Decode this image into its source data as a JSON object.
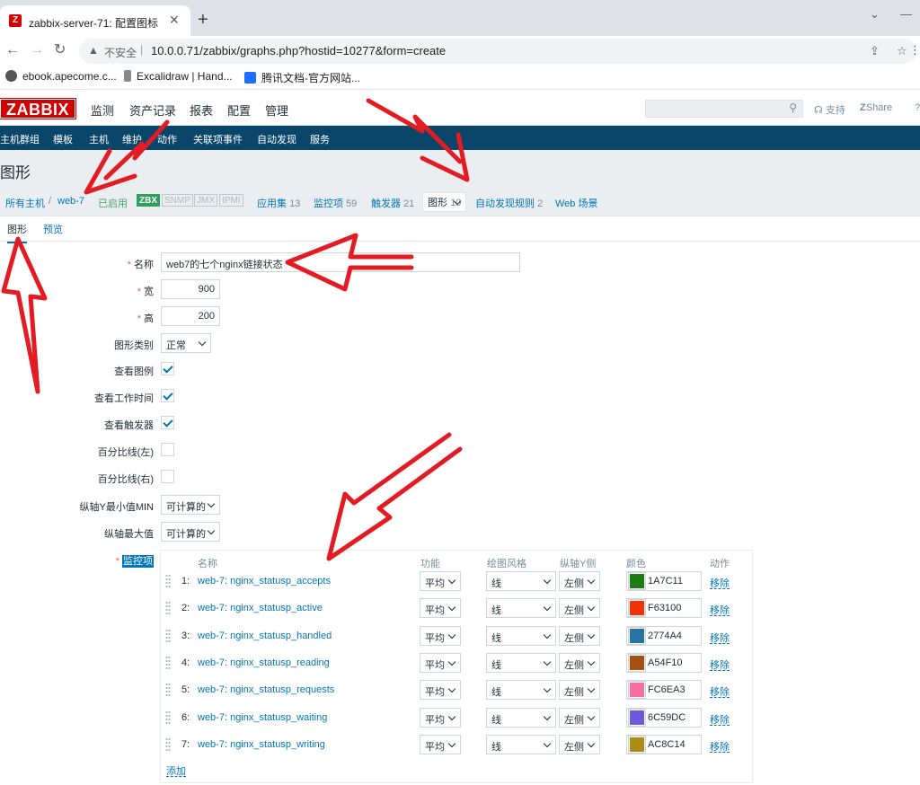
{
  "browser": {
    "tab_title": "zabbix-server-71: 配置图标",
    "url_warning": "不安全",
    "url": "10.0.0.71/zabbix/graphs.php?hostid=10277&form=create",
    "bookmarks": [
      "ebook.apecome.c...",
      "Excalidraw | Hand...",
      "腾讯文档-官方网站..."
    ]
  },
  "header": {
    "logo": "ZABBIX",
    "menu": [
      "监测",
      "资产记录",
      "报表",
      "配置",
      "管理"
    ],
    "support": "支持",
    "share": "Share"
  },
  "submenu": [
    "主机群组",
    "模板",
    "主机",
    "维护",
    "动作",
    "关联项事件",
    "自动发现",
    "服务"
  ],
  "page_title": "图形",
  "breadcrumbs": {
    "all_hosts": "所有主机",
    "separator": "/",
    "host": "web-7",
    "status": "已启用",
    "tags": [
      "ZBX",
      "SNMP",
      "JMX",
      "IPMI"
    ],
    "applications": {
      "label": "应用集",
      "count": "13"
    },
    "items": {
      "label": "监控项",
      "count": "59"
    },
    "triggers": {
      "label": "触发器",
      "count": "21"
    },
    "graphs": {
      "label": "图形",
      "count": "10"
    },
    "discovery": {
      "label": "自动发现规则",
      "count": "2"
    },
    "web": {
      "label": "Web 场景"
    }
  },
  "form_tabs": [
    "图形",
    "预览"
  ],
  "form": {
    "name_label": "名称",
    "name_value": "web7的七个nginx链接状态",
    "width_label": "宽",
    "width_value": "900",
    "height_label": "高",
    "height_value": "200",
    "type_label": "图形类别",
    "type_value": "正常",
    "legend_label": "查看图例",
    "worktime_label": "查看工作时间",
    "triggers_label": "查看触发器",
    "pct_left_label": "百分比线(左)",
    "pct_right_label": "百分比线(右)",
    "ymin_label": "纵轴Y最小值MIN",
    "ymin_value": "可计算的",
    "ymax_label": "纵轴最大值",
    "ymax_value": "可计算的",
    "items_label": "监控项"
  },
  "items_table": {
    "headers": [
      "名称",
      "功能",
      "绘图风格",
      "纵轴Y侧",
      "颜色",
      "动作"
    ],
    "rows": [
      {
        "num": "1:",
        "name": "web-7: nginx_statusp_accepts",
        "func": "平均",
        "style": "线",
        "side": "左侧",
        "color": "1A7C11",
        "action": "移除"
      },
      {
        "num": "2:",
        "name": "web-7: nginx_statusp_active",
        "func": "平均",
        "style": "线",
        "side": "左侧",
        "color": "F63100",
        "action": "移除"
      },
      {
        "num": "3:",
        "name": "web-7: nginx_statusp_handled",
        "func": "平均",
        "style": "线",
        "side": "左侧",
        "color": "2774A4",
        "action": "移除"
      },
      {
        "num": "4:",
        "name": "web-7: nginx_statusp_reading",
        "func": "平均",
        "style": "线",
        "side": "左侧",
        "color": "A54F10",
        "action": "移除"
      },
      {
        "num": "5:",
        "name": "web-7: nginx_statusp_requests",
        "func": "平均",
        "style": "线",
        "side": "左侧",
        "color": "FC6EA3",
        "action": "移除"
      },
      {
        "num": "6:",
        "name": "web-7: nginx_statusp_waiting",
        "func": "平均",
        "style": "线",
        "side": "左侧",
        "color": "6C59DC",
        "action": "移除"
      },
      {
        "num": "7:",
        "name": "web-7: nginx_statusp_writing",
        "func": "平均",
        "style": "线",
        "side": "左侧",
        "color": "AC8C14",
        "action": "移除"
      }
    ],
    "add_link": "添加"
  },
  "colors": {
    "brand": "#d40000",
    "submenu_bg": "#0a466a",
    "link": "#0275b8",
    "annotation": "#e31b23"
  }
}
